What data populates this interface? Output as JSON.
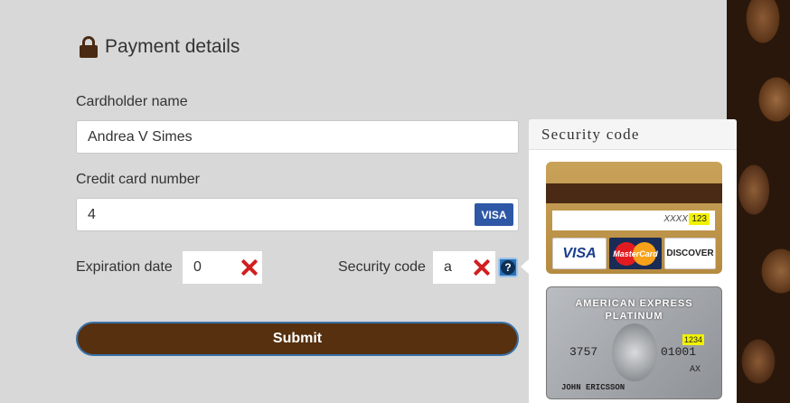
{
  "form": {
    "title": "Payment details",
    "cardholder": {
      "label": "Cardholder name",
      "value": "Andrea V Simes"
    },
    "card_number": {
      "label": "Credit card number",
      "value": "4",
      "brand": "VISA"
    },
    "expiration": {
      "label": "Expiration date",
      "value": "0"
    },
    "security_code": {
      "label": "Security code",
      "value": "a",
      "help_symbol": "?"
    },
    "submit_label": "Submit"
  },
  "popover": {
    "title": "Security code",
    "card_back": {
      "digits": "XXXX",
      "cvv": "123",
      "logos": [
        "VISA",
        "MasterCard",
        "DISCOVER"
      ]
    },
    "amex": {
      "title": "AMERICAN EXPRESS",
      "subtitle": "PLATINUM",
      "cvv": "1234",
      "number_left": "3757",
      "number_right": "01001",
      "suffix": "AX",
      "name": "JOHN ERICSSON"
    }
  },
  "icons": [
    "lock-icon",
    "invalid-x-icon",
    "help-icon"
  ],
  "colors": {
    "brand_brown": "#56300f",
    "error_red": "#d11f1f",
    "visa_blue": "#2e57a5",
    "background": "#d8d8d8"
  }
}
